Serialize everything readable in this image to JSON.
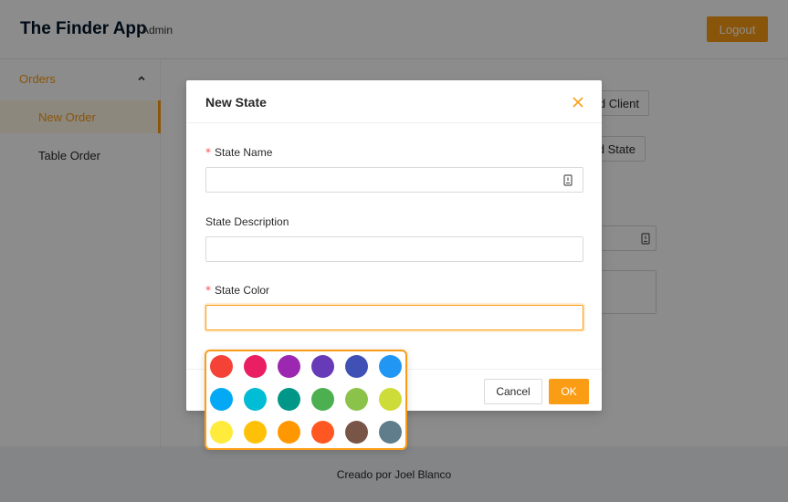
{
  "header": {
    "app_title": "The Finder App",
    "role": "Admin",
    "logout_label": "Logout"
  },
  "sidebar": {
    "submenu_label": "Orders",
    "items": [
      {
        "label": "New Order",
        "active": true
      },
      {
        "label": "Table Order",
        "active": false
      }
    ]
  },
  "content": {
    "add_client_label": "d Client",
    "add_state_label": "d State"
  },
  "footer": {
    "text": "Creado por Joel Blanco"
  },
  "modal": {
    "title": "New State",
    "fields": {
      "name": {
        "label": "State Name",
        "value": ""
      },
      "description": {
        "label": "State Description",
        "value": ""
      },
      "color": {
        "label": "State Color",
        "value": ""
      }
    },
    "cancel_label": "Cancel",
    "ok_label": "OK"
  },
  "color_picker": {
    "colors": [
      "#f44336",
      "#e91e63",
      "#9c27b0",
      "#673ab7",
      "#3f51b5",
      "#2196f3",
      "#03a9f4",
      "#00bcd4",
      "#009688",
      "#4caf50",
      "#8bc34a",
      "#cddc39",
      "#ffeb3b",
      "#ffc107",
      "#ff9800",
      "#ff5722",
      "#795548",
      "#607d8b"
    ]
  },
  "theme": {
    "accent": "#fa9c14",
    "danger": "#ff4d4f"
  }
}
